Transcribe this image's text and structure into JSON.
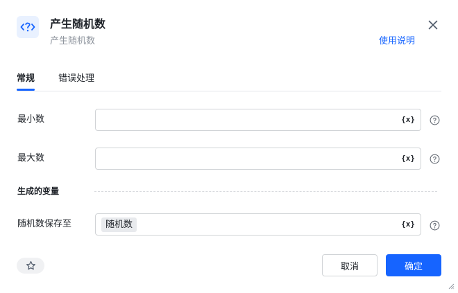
{
  "dialog": {
    "title": "产生随机数",
    "subtitle": "产生随机数",
    "help_link": "使用说明"
  },
  "tabs": [
    {
      "label": "常规",
      "active": true
    },
    {
      "label": "错误处理",
      "active": false
    }
  ],
  "fields": {
    "min": {
      "label": "最小数",
      "value": "",
      "var_button": "{x}"
    },
    "max": {
      "label": "最大数",
      "value": "",
      "var_button": "{x}"
    }
  },
  "generated_variables": {
    "section_title": "生成的变量",
    "save_to": {
      "label": "随机数保存至",
      "tag": "随机数",
      "var_button": "{x}"
    }
  },
  "footer": {
    "cancel_label": "取消",
    "ok_label": "确定"
  },
  "colors": {
    "accent": "#1664ff",
    "icon_bg": "#e9f1ff"
  },
  "icons": {
    "header": "random-question-code-icon",
    "close": "close-icon",
    "help": "question-circle-icon",
    "favorite": "star-icon",
    "resize": "resize-handle-icon"
  }
}
